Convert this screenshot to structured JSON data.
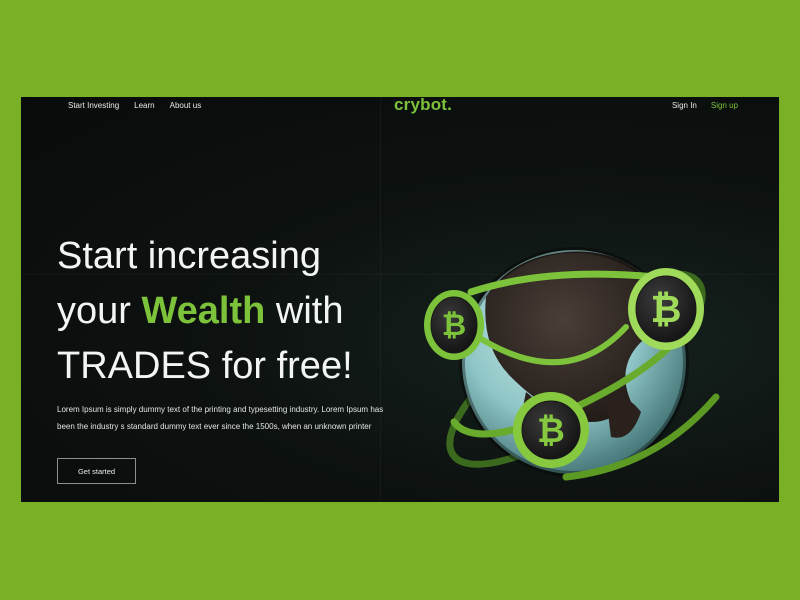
{
  "nav": {
    "links": [
      "Start Investing",
      "Learn",
      "About us"
    ],
    "brand": "crybot.",
    "sign_in": "Sign In",
    "sign_up": "Sign up"
  },
  "hero": {
    "line1": "Start increasing",
    "line2_pre": "your ",
    "line2_accent": "Wealth",
    "line2_post": " with",
    "line3": "TRADES for free!",
    "description": "Lorem Ipsum is simply dummy text of the printing and typesetting industry. Lorem Ipsum has been the industry s standard dummy text ever since the 1500s, when an unknown printer",
    "cta_label": "Get started"
  },
  "colors": {
    "page_background": "#79b025",
    "accent": "#7cc23a",
    "hero_background": "#0b0f0d"
  },
  "icons": [
    "bitcoin-coin-icon",
    "globe-illustration"
  ]
}
